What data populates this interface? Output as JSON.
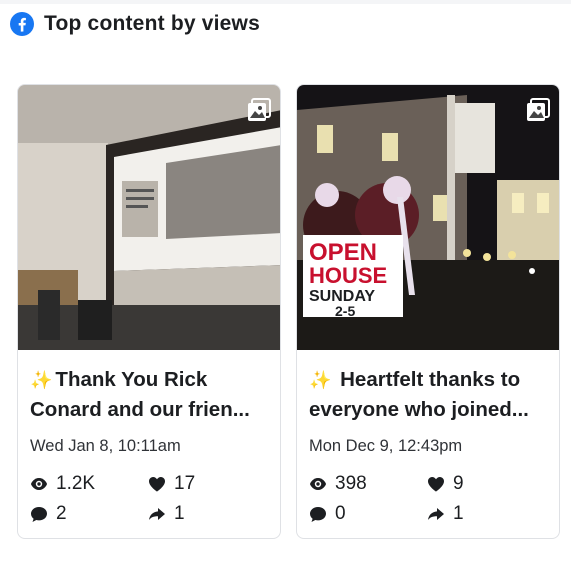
{
  "header": {
    "title": "Top content by views",
    "logo_icon": "facebook-icon"
  },
  "colors": {
    "facebook_blue": "#1877f2",
    "sparkle": "#f5c342",
    "open_house_red": "#c8102e"
  },
  "cards": [
    {
      "caption_line1": "Thank You Rick",
      "caption_line2": "Conard and our frien...",
      "date": "Wed Jan 8, 10:11am",
      "views": "1.2K",
      "likes": "17",
      "comments": "2",
      "shares": "1",
      "media_icon": "photo-album-icon"
    },
    {
      "caption_line1": "Heartfelt thanks to",
      "caption_line2": "everyone who joined...",
      "date": "Mon Dec 9, 12:43pm",
      "views": "398",
      "likes": "9",
      "comments": "0",
      "shares": "1",
      "media_icon": "photo-album-icon",
      "sign_text": {
        "line1": "OPEN",
        "line2": "HOUSE",
        "line3": "SUNDAY",
        "line4": "2-5"
      }
    }
  ]
}
